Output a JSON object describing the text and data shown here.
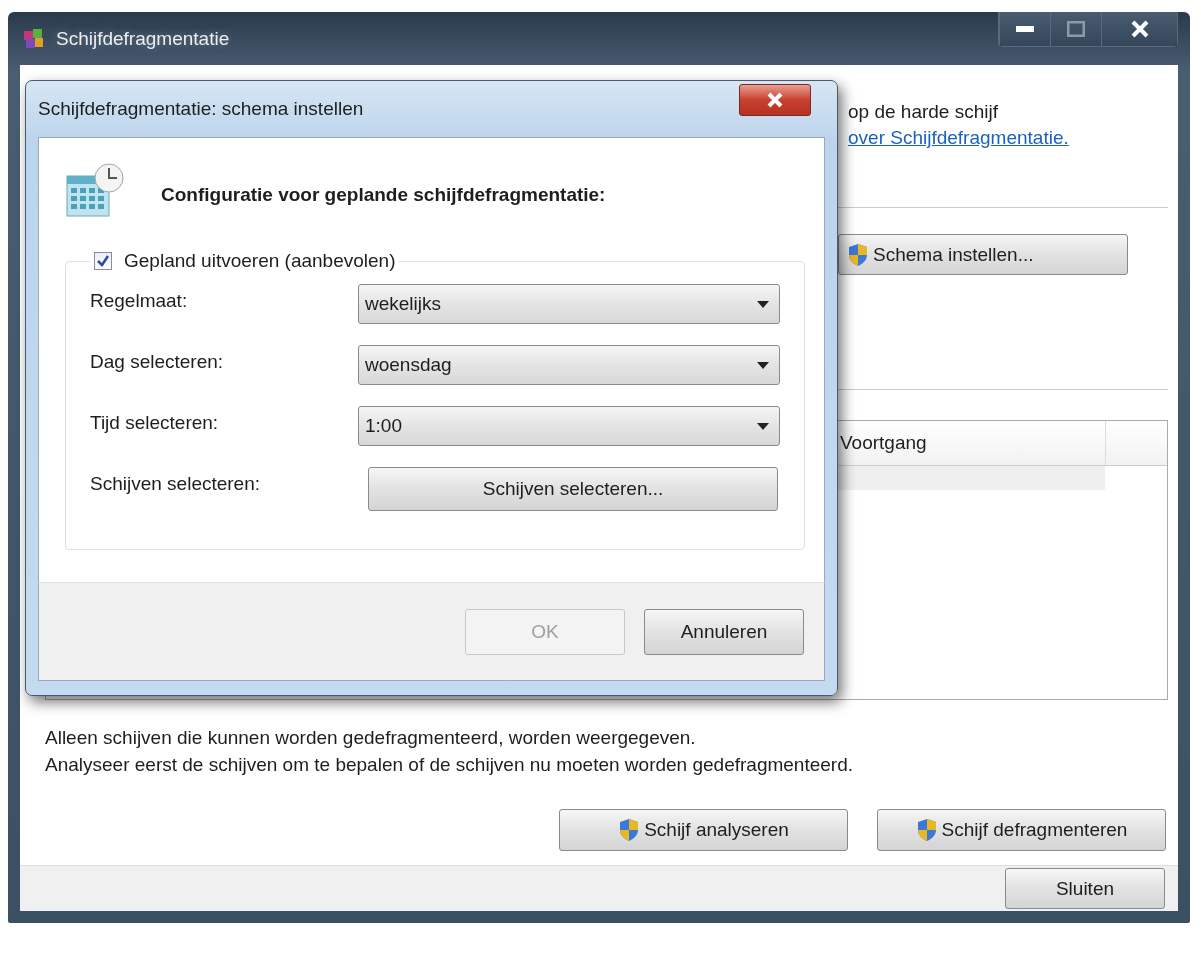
{
  "window": {
    "title": "Schijfdefragmentatie"
  },
  "main": {
    "intro_text": "op de harde schijf",
    "help_link": "over Schijfdefragmentatie.",
    "schedule_button": "Schema instellen...",
    "table": {
      "columns": [
        "Voortgang"
      ]
    },
    "notes": [
      "Alleen schijven die kunnen worden gedefragmenteerd, worden weergegeven.",
      "Analyseer eerst de schijven om te bepalen of de schijven nu moeten worden gedefragmenteerd."
    ],
    "buttons": [
      "Schijf analyseren",
      "Schijf defragmenteren"
    ],
    "close_button": "Sluiten"
  },
  "dialog": {
    "title": "Schijfdefragmentatie: schema instellen",
    "heading": "Configuratie voor geplande schijfdefragmentatie:",
    "scheduled": {
      "label": "Gepland uitvoeren (aanbevolen)",
      "checked": true
    },
    "fields": [
      {
        "kind": "dropdown",
        "label": "Regelmaat:",
        "value": "wekelijks"
      },
      {
        "kind": "dropdown",
        "label": "Dag selecteren:",
        "value": "woensdag"
      },
      {
        "kind": "dropdown",
        "label": "Tijd selecteren:",
        "value": "1:00"
      },
      {
        "kind": "button",
        "label": "Schijven selecteren:",
        "value": "Schijven selecteren..."
      }
    ],
    "buttons": [
      {
        "label": "OK",
        "disabled": true
      },
      {
        "label": "Annuleren",
        "disabled": false
      }
    ]
  }
}
